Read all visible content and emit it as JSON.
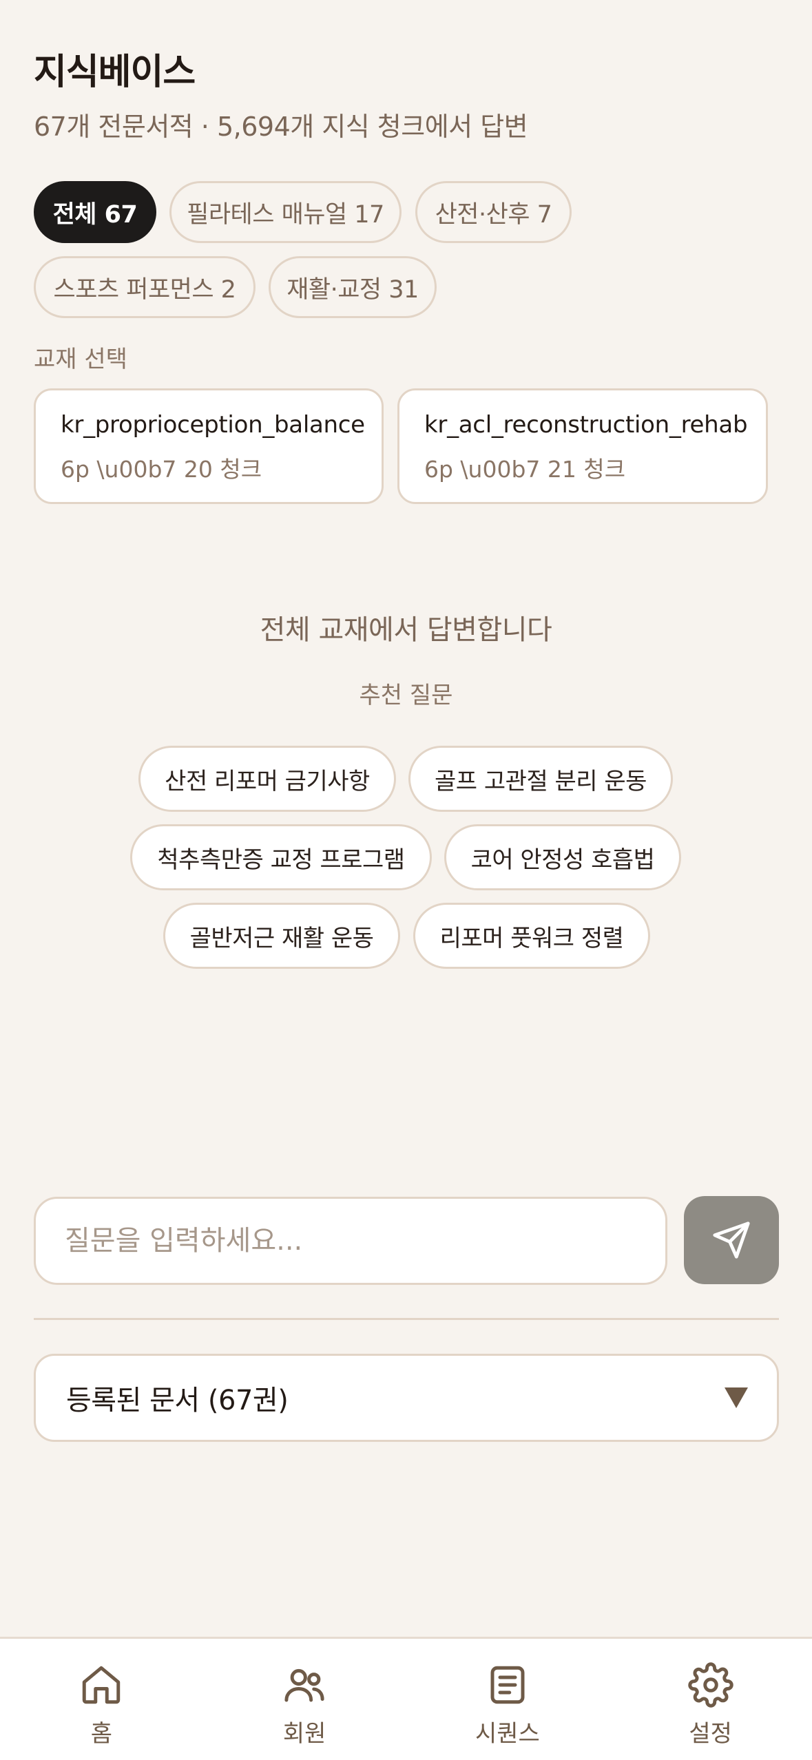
{
  "header": {
    "title": "지식베이스",
    "subtitle": "67개 전문서적 · 5,694개 지식 청크에서 답변"
  },
  "filters": [
    {
      "label": "전체 67",
      "active": true
    },
    {
      "label": "필라테스 매뉴얼 17",
      "active": false
    },
    {
      "label": "산전·산후 7",
      "active": false
    },
    {
      "label": "스포츠 퍼포먼스 2",
      "active": false
    },
    {
      "label": "재활·교정 31",
      "active": false
    }
  ],
  "book_section": {
    "label": "교재 선택",
    "books": [
      {
        "title": "kr_proprioception_balance",
        "meta": "6p \\u00b7 20 청크"
      },
      {
        "title": "kr_acl_reconstruction_rehab",
        "meta": "6p \\u00b7 21 청크"
      }
    ]
  },
  "empty_state": {
    "heading": "전체 교재에서 답변합니다",
    "suggest_label": "추천 질문",
    "questions": [
      "산전 리포머 금기사항",
      "골프 고관절 분리 운동",
      "척추측만증 교정 프로그램",
      "코어 안정성 호흡법",
      "골반저근 재활 운동",
      "리포머 풋워크 정렬"
    ]
  },
  "composer": {
    "placeholder": "질문을 입력하세요...",
    "send_icon": "send-icon"
  },
  "documents": {
    "label": "등록된 문서 (67권)"
  },
  "tabbar": [
    {
      "label": "홈",
      "icon": "home-icon"
    },
    {
      "label": "회원",
      "icon": "members-icon"
    },
    {
      "label": "시퀀스",
      "icon": "sequence-icon"
    },
    {
      "label": "설정",
      "icon": "settings-icon"
    }
  ],
  "colors": {
    "background": "#f7f3ee",
    "active_chip": "#1d1b1a",
    "border": "#e2d4c6",
    "send_button": "#8e8b84",
    "muted_text": "#7a6657"
  }
}
